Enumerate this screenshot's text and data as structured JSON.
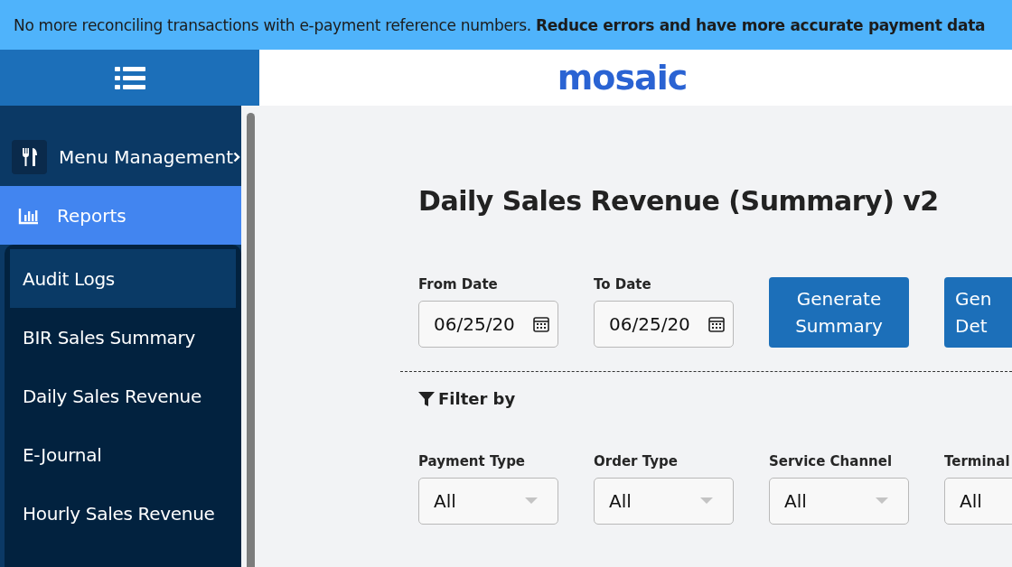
{
  "banner": {
    "text": "No more reconciling transactions with e-payment reference numbers. **Reduce errors and have more accurate payment data**"
  },
  "header": {
    "logo": "mosaic"
  },
  "sidebar": {
    "items": [
      {
        "label": "Menu Management",
        "kind": "menu",
        "selected": false,
        "expanded": false
      },
      {
        "label": "Reports",
        "kind": "chart",
        "selected": true,
        "expanded": true,
        "children": [
          {
            "label": "Audit Logs",
            "selected": true
          },
          {
            "label": "BIR Sales Summary",
            "selected": false
          },
          {
            "label": "Daily Sales Revenue",
            "selected": false
          },
          {
            "label": "E-Journal",
            "selected": false
          },
          {
            "label": "Hourly Sales Revenue",
            "selected": false
          }
        ]
      }
    ]
  },
  "page": {
    "title": "Daily Sales Revenue (Summary) v2",
    "dates": [
      {
        "label": "From Date",
        "value": "06/25/20"
      },
      {
        "label": "To Date",
        "value": "06/25/20"
      }
    ],
    "buttons": [
      {
        "lines": [
          "Generate",
          "Summary"
        ]
      },
      {
        "lines": [
          "Gen",
          "Det"
        ]
      }
    ],
    "filter_title": "Filter by",
    "filters": [
      {
        "label": "Payment Type",
        "value": "All"
      },
      {
        "label": "Order Type",
        "value": "All"
      },
      {
        "label": "Service Channel",
        "value": "All"
      },
      {
        "label": "Terminal",
        "value": "All"
      }
    ]
  }
}
